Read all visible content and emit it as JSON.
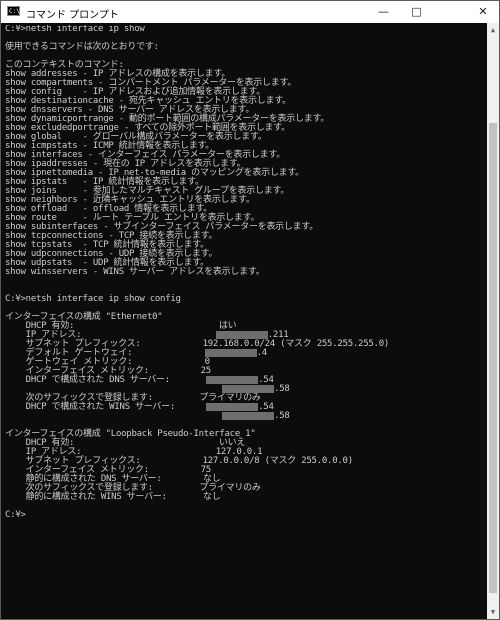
{
  "window": {
    "title": "コマンド プロンプト",
    "icon_label": "C:\\",
    "minimize_icon": "minimize-icon",
    "maximize_icon": "maximize-icon",
    "close_icon": "close-icon"
  },
  "console": {
    "lines": [
      "C:¥>netsh interface ip show",
      "",
      "使用できるコマンドは次のとおりです:",
      "",
      "このコンテキストのコマンド:",
      "show addresses - IP アドレスの構成を表示します。",
      "show compartments - コンパートメント パラメーターを表示します。",
      "show config    - IP アドレスおよび追加情報を表示します。",
      "show destinationcache - 宛先キャッシュ エントリを表示します。",
      "show dnsservers - DNS サーバー アドレスを表示します。",
      "show dynamicportrange - 動的ポート範囲の構成パラメーターを表示します。",
      "show excludedportrange - すべての除外ポート範囲を表示します。",
      "show global    - グローバル構成パラメーターを表示します。",
      "show icmpstats - ICMP 統計情報を表示します。",
      "show interfaces - インターフェイス パラメーターを表示します。",
      "show ipaddresses - 現在の IP アドレスを表示します。",
      "show ipnettomedia - IP net-to-media のマッピングを表示します。",
      "show ipstats   - IP 統計情報を表示します。",
      "show joins     - 参加したマルチキャスト グループを表示します。",
      "show neighbors - 近隣キャッシュ エントリを表示します。",
      "show offload   - offload 情報を表示します。",
      "show route     - ルート テーブル エントリを表示します。",
      "show subinterfaces - サブインターフェイス パラメーターを表示します。",
      "show tcpconnections - TCP 接続を表示します。",
      "show tcpstats  - TCP 統計情報を表示します。",
      "show udpconnections - UDP 接続を表示します。",
      "show udpstats  - UDP 統計情報を表示します。",
      "show winsservers - WINS サーバー アドレスを表示します。",
      "",
      "",
      "C:¥>netsh interface ip show config",
      "",
      "インターフェイスの構成 \"Ethernet0\"",
      "    DHCP 有効:                            はい",
      "    IP アドレス:                          {R}.211",
      "    サブネット プレフィックス:            192.168.0.0/24 (マスク 255.255.255.0)",
      "    デフォルト ゲートウェイ:              {R}.4",
      "    ゲートウェイ メトリック:              0",
      "    インターフェイス メトリック:          25",
      "    DHCP で構成された DNS サーバー:       {R}.54",
      "                                          {R}.58",
      "    次のサフィックスで登録します:         プライマリのみ",
      "    DHCP で構成された WINS サーバー:      {R}.54",
      "                                          {R}.58",
      "",
      "インターフェイスの構成 \"Loopback Pseudo-Interface 1\"",
      "    DHCP 有効:                            いいえ",
      "    IP アドレス:                          127.0.0.1",
      "    サブネット プレフィックス:            127.0.0.0/8 (マスク 255.0.0.0)",
      "    インターフェイス メトリック:          75",
      "    静的に構成された DNS サーバー:        なし",
      "    次のサフィックスで登録します:         プライマリのみ",
      "    静的に構成された WINS サーバー:       なし",
      "",
      "C:¥>"
    ]
  }
}
